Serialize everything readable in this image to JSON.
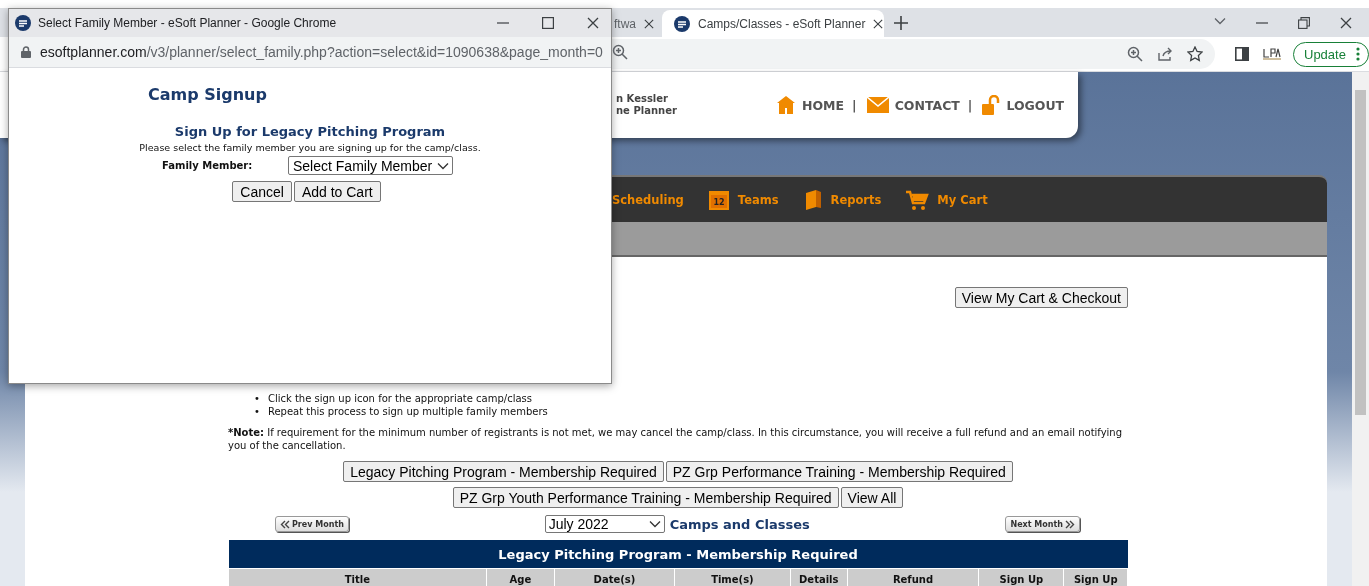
{
  "browser": {
    "tabs": [
      {
        "title": "ftwa",
        "selected": false
      },
      {
        "title": "Camps/Classes - eSoft Planner",
        "selected": true
      }
    ],
    "update_button": "Update"
  },
  "site": {
    "user_lines": [
      "n Kessler",
      "ne Planner"
    ],
    "top_links": [
      {
        "label": "HOME",
        "kind": "house",
        "separator": "|"
      },
      {
        "label": "CONTACT",
        "kind": "envelope",
        "separator": "|"
      },
      {
        "label": "LOGOUT",
        "kind": "padlock"
      }
    ],
    "nav": [
      {
        "label": "Scheduling"
      },
      {
        "label": "Teams",
        "kind": "calendar",
        "icon_text": "12"
      },
      {
        "label": "Reports",
        "kind": "book"
      },
      {
        "label": "My Cart",
        "kind": "cart"
      }
    ],
    "checkout_button": "View My Cart & Checkout",
    "steps": [
      {
        "bullet": "•",
        "text": "Click the sign up icon for the appropriate camp/class"
      },
      {
        "bullet": "•",
        "text": "Repeat this process to sign up multiple family members"
      }
    ],
    "note_label": "*Note:",
    "note_text": " If requirement for the minimum number of registrants is not met, we may cancel the camp/class. In this circumstance, you will receive a full refund and an email notifying you of the cancellation.",
    "filter_rows": [
      [
        "Legacy Pitching Program - Membership Required",
        "PZ Grp Performance Training - Membership Required"
      ],
      [
        "PZ Grp Youth Performance Training - Membership Required",
        "View All"
      ]
    ],
    "prev_month": "Prev Month",
    "month_select": "July 2022",
    "calendar_heading": "Camps and Classes",
    "next_month": "Next Month",
    "table": {
      "title": "Legacy Pitching Program - Membership Required",
      "columns": [
        "Title",
        "Age",
        "Date(s)",
        "Time(s)",
        "Details",
        "Refund",
        "Sign Up",
        "Sign Up"
      ]
    }
  },
  "popup": {
    "window_title": "Select Family Member - eSoft Planner - Google Chrome",
    "url_host": "esoftplanner.com",
    "url_path": "/v3/planner/select_family.php?action=select&id=1090638&page_month=0",
    "heading": "Camp Signup",
    "subheading": "Sign Up for Legacy Pitching Program",
    "instruction": "Please select the family member you are signing up for the camp/class.",
    "field_label": "Family Member:",
    "field_value": "Select Family Member",
    "buttons": [
      "Cancel",
      "Add to Cart"
    ]
  }
}
